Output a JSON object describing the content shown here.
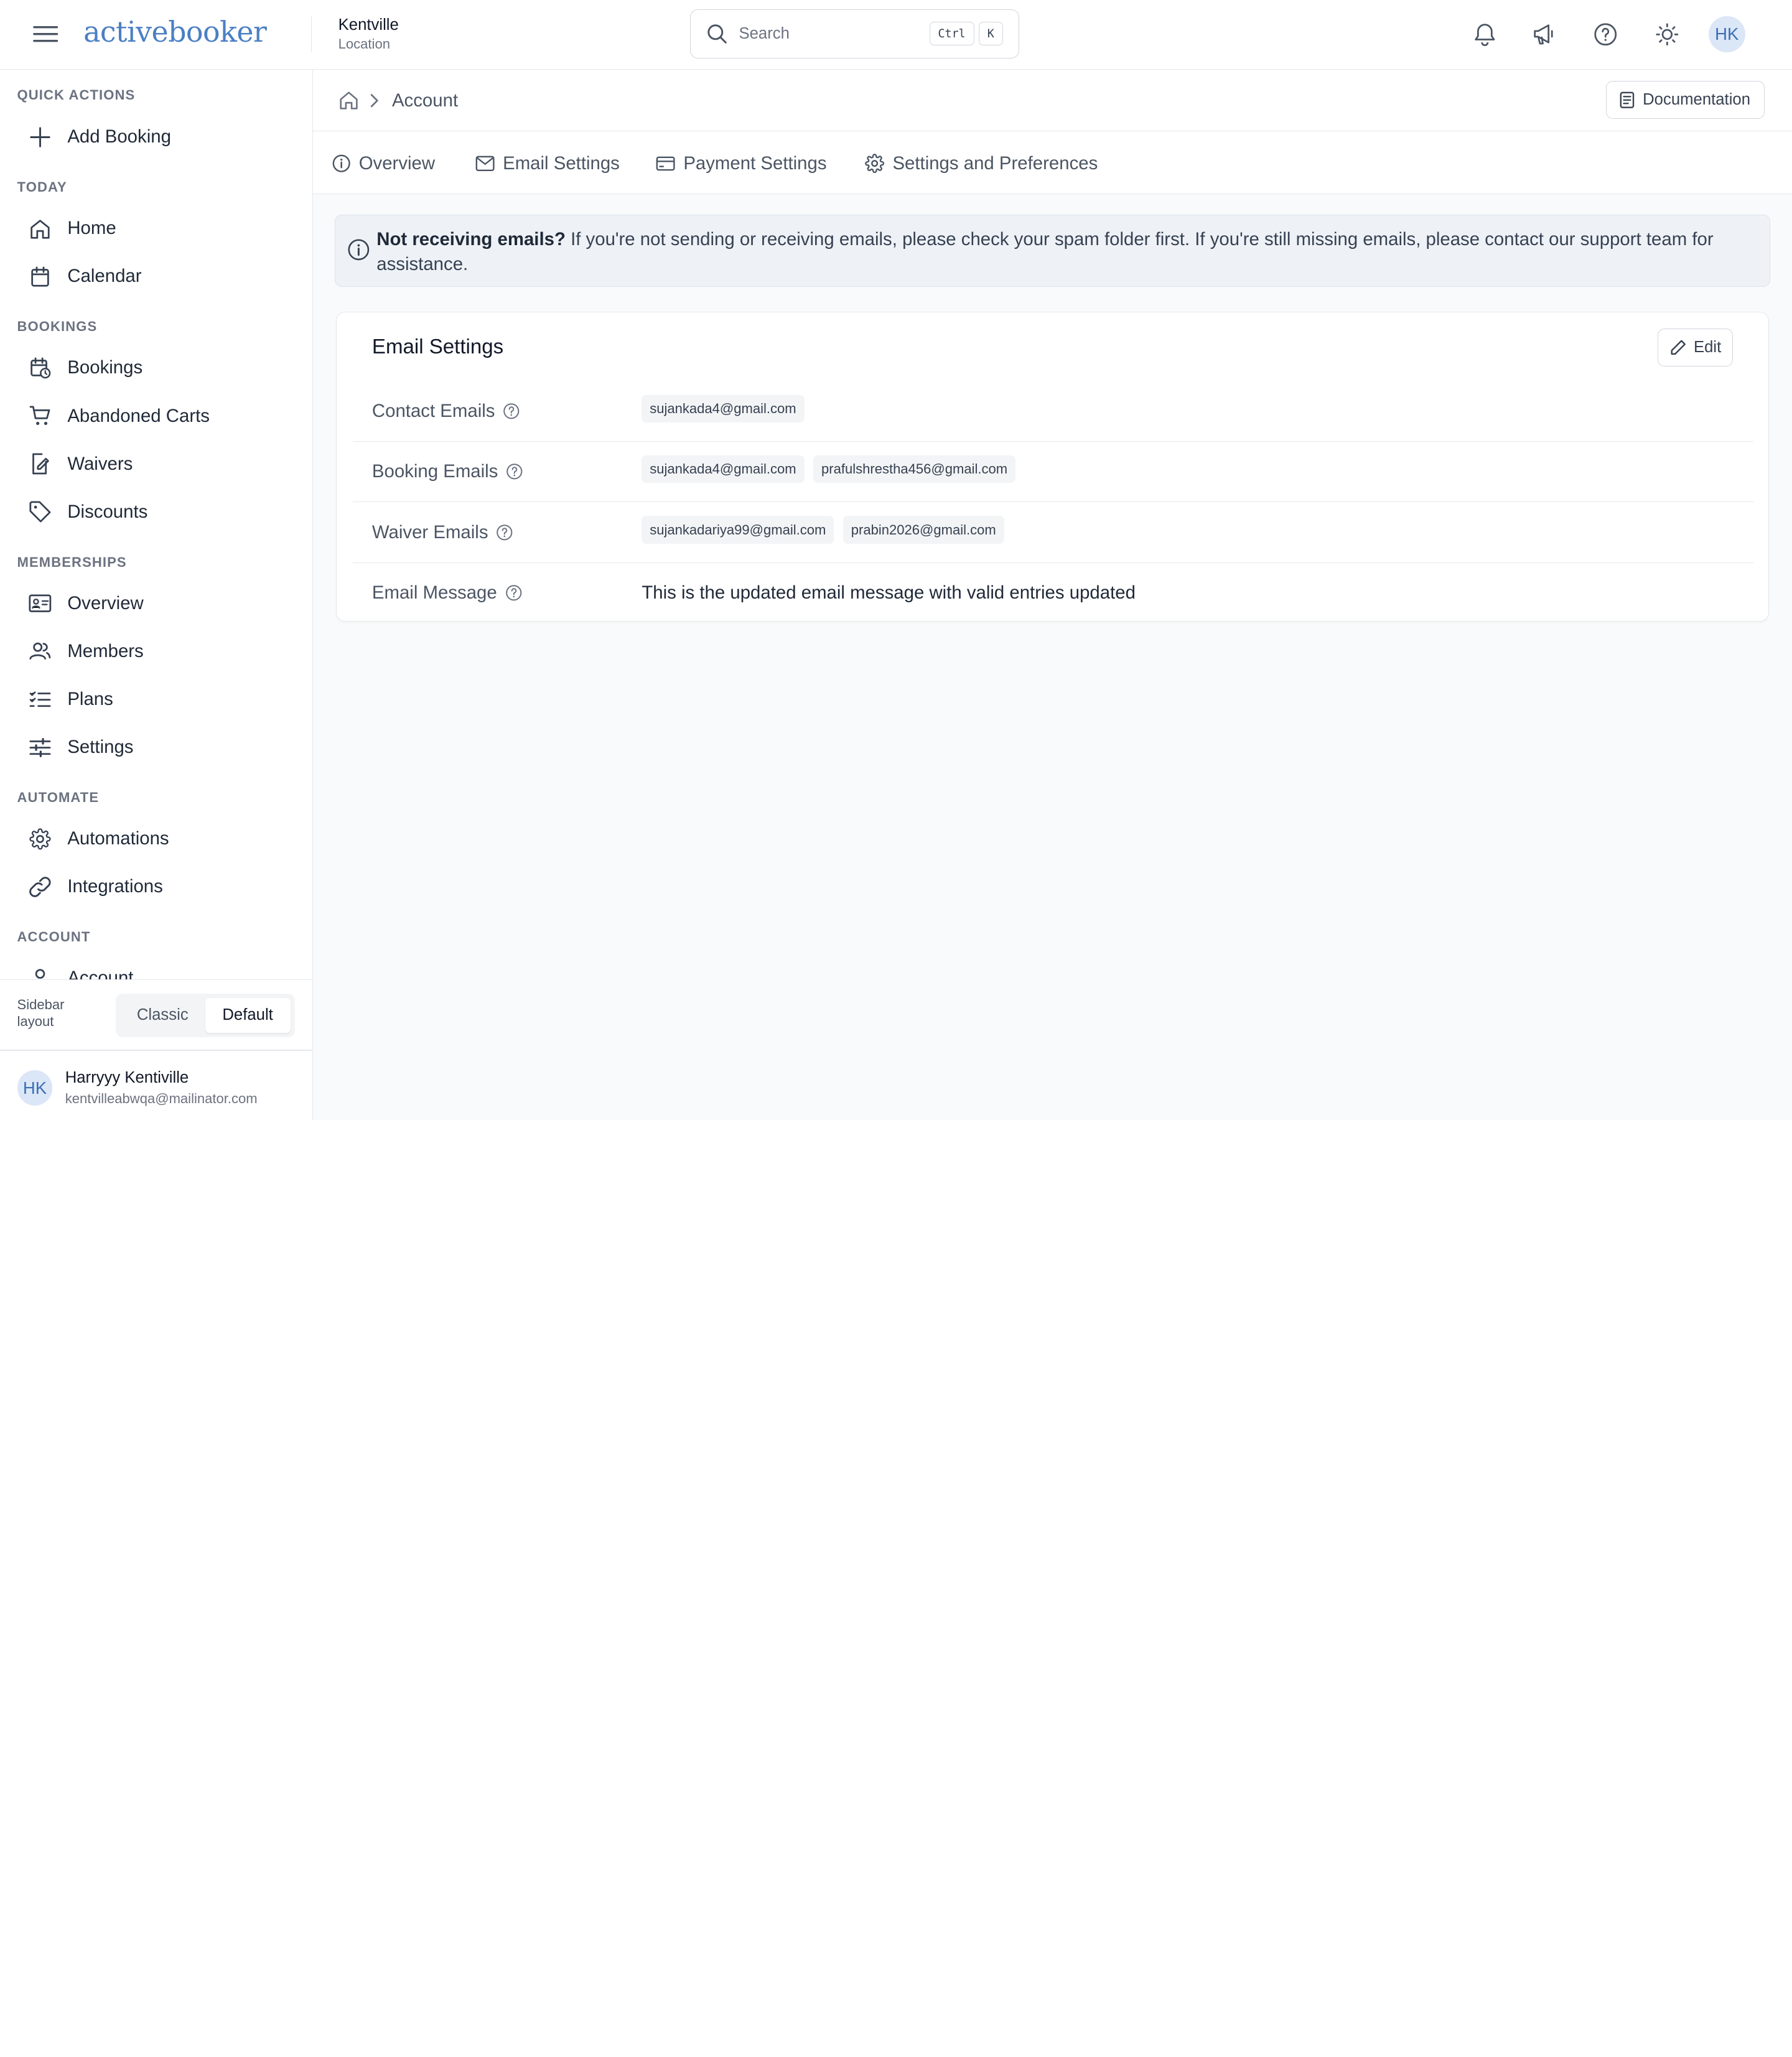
{
  "header": {
    "logo_text": "activebooker",
    "location_name": "Kentville",
    "location_sub": "Location",
    "search_placeholder": "Search",
    "shortcut_ctrl": "Ctrl",
    "shortcut_key": "K",
    "avatar_initials": "HK"
  },
  "sidebar": {
    "sections": {
      "quick_actions": "QUICK ACTIONS",
      "today": "TODAY",
      "bookings": "BOOKINGS",
      "memberships": "MEMBERSHIPS",
      "automate": "AUTOMATE",
      "account": "ACCOUNT"
    },
    "items": {
      "add_booking": "Add Booking",
      "home": "Home",
      "calendar": "Calendar",
      "bookings": "Bookings",
      "abandoned_carts": "Abandoned Carts",
      "waivers": "Waivers",
      "discounts": "Discounts",
      "overview": "Overview",
      "members": "Members",
      "plans": "Plans",
      "settings": "Settings",
      "automations": "Automations",
      "integrations": "Integrations",
      "account": "Account"
    },
    "layout_label": "Sidebar layout",
    "layout_options": [
      "Classic",
      "Default"
    ],
    "layout_selected": "Default",
    "user": {
      "initials": "HK",
      "name": "Harryyy Kentiville",
      "email": "kentvilleabwqa@mailinator.com"
    }
  },
  "breadcrumb": {
    "current": "Account",
    "documentation_label": "Documentation"
  },
  "tabs": [
    "Overview",
    "Email Settings",
    "Payment Settings",
    "Settings and Preferences"
  ],
  "alert": {
    "title": "Not receiving emails?",
    "message": " If you're not sending or receiving emails, please check your spam folder first. If you're still missing emails, please contact our support team for assistance."
  },
  "email_settings": {
    "title": "Email Settings",
    "edit_label": "Edit",
    "contact_label": "Contact Emails",
    "contact_emails": [
      "sujankada4@gmail.com"
    ],
    "booking_label": "Booking Emails",
    "booking_emails": [
      "sujankada4@gmail.com",
      "prafulshrestha456@gmail.com"
    ],
    "waiver_label": "Waiver Emails",
    "waiver_emails": [
      "sujankadariya99@gmail.com",
      "prabin2026@gmail.com"
    ],
    "message_label": "Email Message",
    "message_value": "This is the updated email message with valid entries updated"
  },
  "colors": {
    "brand": "#4a7fc4",
    "alert_bg": "#eef2f7",
    "chip_bg": "#f3f4f6"
  },
  "icons": {
    "menu": "hamburger-menu-icon",
    "search": "search-icon",
    "notifications": "bell-icon",
    "announcements": "megaphone-icon",
    "help": "question-circle-icon",
    "theme": "sun-icon"
  }
}
